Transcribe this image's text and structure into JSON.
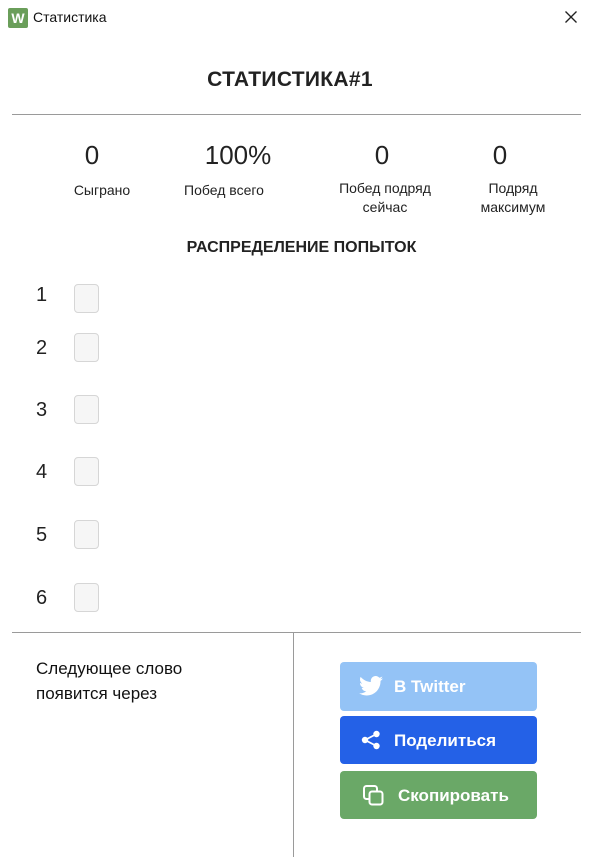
{
  "window": {
    "title": "Статистика",
    "app_icon_letter": "W"
  },
  "header": {
    "title": "СТАТИСТИКА#1"
  },
  "stats": [
    {
      "value": "0",
      "label": "Сыграно"
    },
    {
      "value": "100%",
      "label": "Побед всего"
    },
    {
      "value": "0",
      "label_line1": "Побед подряд",
      "label_line2": "сейчас"
    },
    {
      "value": "0",
      "label_line1": "Подряд",
      "label_line2": "максимум"
    }
  ],
  "distribution": {
    "title": "РАСПРЕДЕЛЕНИЕ ПОПЫТОК",
    "rows": [
      {
        "guess": "1",
        "count": 0
      },
      {
        "guess": "2",
        "count": 0
      },
      {
        "guess": "3",
        "count": 0
      },
      {
        "guess": "4",
        "count": 0
      },
      {
        "guess": "5",
        "count": 0
      },
      {
        "guess": "6",
        "count": 0
      }
    ]
  },
  "next_word": {
    "line1": "Следующее слово",
    "line2": "появится через"
  },
  "buttons": {
    "twitter_label": "В Twitter",
    "share_label": "Поделиться",
    "copy_label": "Скопировать"
  },
  "colors": {
    "twitter_button": "#94c3f6",
    "share_button": "#2461e7",
    "copy_button": "#6aa867",
    "app_icon": "#6a9e5a"
  },
  "icons": {
    "app": "wordle-app-icon",
    "close": "close-icon",
    "twitter": "twitter-bird-icon",
    "share": "share-icon",
    "copy": "copy-icon"
  }
}
